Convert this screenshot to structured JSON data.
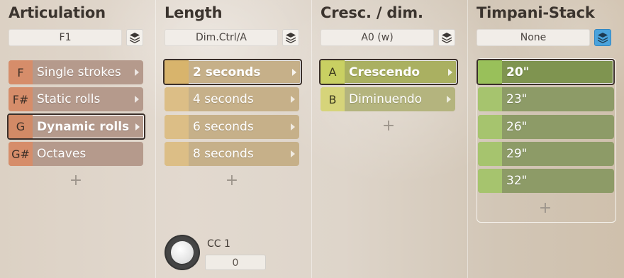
{
  "columns": {
    "articulation": {
      "title": "Articulation",
      "field_value": "F1",
      "slots": [
        {
          "key": "F",
          "label": "Single strokes"
        },
        {
          "key": "F#",
          "label": "Static rolls"
        },
        {
          "key": "G",
          "label": "Dynamic rolls"
        },
        {
          "key": "G#",
          "label": "Octaves"
        }
      ],
      "add": "+"
    },
    "length": {
      "title": "Length",
      "field_value": "Dim.Ctrl/A",
      "slots": [
        {
          "key": "",
          "label": "2 seconds"
        },
        {
          "key": "",
          "label": "4 seconds"
        },
        {
          "key": "",
          "label": "6 seconds"
        },
        {
          "key": "",
          "label": "8 seconds"
        }
      ],
      "add": "+",
      "cc_label": "CC 1",
      "cc_value": "0"
    },
    "cresc": {
      "title": "Cresc. / dim.",
      "field_value": "A0 (w)",
      "slots": [
        {
          "key": "A",
          "label": "Crescendo"
        },
        {
          "key": "B",
          "label": "Diminuendo"
        }
      ],
      "add": "+"
    },
    "timpani": {
      "title": "Timpani-Stack",
      "field_value": "None",
      "slots": [
        {
          "key": "",
          "label": "20\""
        },
        {
          "key": "",
          "label": "23\""
        },
        {
          "key": "",
          "label": "26\""
        },
        {
          "key": "",
          "label": "29\""
        },
        {
          "key": "",
          "label": "32\""
        }
      ],
      "add": "+"
    }
  },
  "icons": {
    "stack": "layers-stack-icon",
    "arrow": "chevron-right-icon",
    "knob": "rotary-knob"
  },
  "colors": {
    "stack_active": "#4aa3dc",
    "selected_border": "#3a2f2a"
  }
}
